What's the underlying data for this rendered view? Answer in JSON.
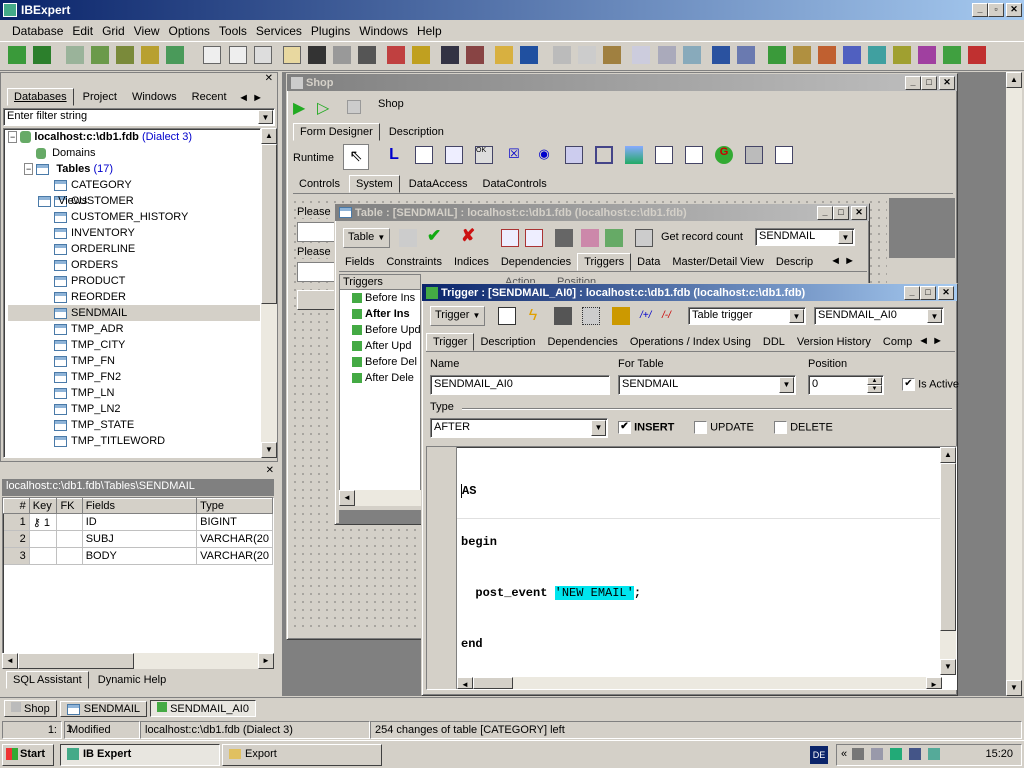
{
  "app": {
    "title": "IBExpert"
  },
  "menu": [
    "Database",
    "Edit",
    "Grid",
    "View",
    "Options",
    "Tools",
    "Services",
    "Plugins",
    "Windows",
    "Help"
  ],
  "dbexplorer": {
    "tabs": [
      "Databases",
      "Project",
      "Windows",
      "Recent"
    ],
    "filter_placeholder": "Enter filter string",
    "server": "localhost:c:\\db1.fdb",
    "dialect": "(Dialect 3)",
    "domains": "Domains",
    "tables_label": "Tables",
    "tables_count": "(17)",
    "tables": [
      "CATEGORY",
      "CUSTOMER",
      "CUSTOMER_HISTORY",
      "INVENTORY",
      "ORDERLINE",
      "ORDERS",
      "PRODUCT",
      "REORDER",
      "SENDMAIL",
      "TMP_ADR",
      "TMP_CITY",
      "TMP_FN",
      "TMP_FN2",
      "TMP_LN",
      "TMP_LN2",
      "TMP_STATE",
      "TMP_TITLEWORD"
    ],
    "views": "Views"
  },
  "fieldpanel": {
    "path": "localhost:c:\\db1.fdb\\Tables\\SENDMAIL",
    "headers": [
      "#",
      "Key",
      "FK",
      "Fields",
      "Type"
    ],
    "rows": [
      {
        "num": "1",
        "key": "⚷ 1",
        "field": "ID",
        "type": "BIGINT"
      },
      {
        "num": "2",
        "key": "",
        "field": "SUBJ",
        "type": "VARCHAR(20"
      },
      {
        "num": "3",
        "key": "",
        "field": "BODY",
        "type": "VARCHAR(20"
      }
    ],
    "bottom_tabs": [
      "SQL Assistant",
      "Dynamic Help"
    ]
  },
  "shop": {
    "title": "Shop",
    "name": "Shop",
    "tabs": [
      "Form Designer",
      "Description"
    ],
    "runtime": "Runtime",
    "palette_tabs": [
      "Controls",
      "System",
      "DataAccess",
      "DataControls"
    ],
    "please1": "Please",
    "please2": "Please"
  },
  "table": {
    "title": "Table : [SENDMAIL] : localhost:c:\\db1.fdb (localhost:c:\\db1.fdb)",
    "table_btn": "Table",
    "record_count": "Get record count",
    "table_name": "SENDMAIL",
    "tabs": [
      "Fields",
      "Constraints",
      "Indices",
      "Dependencies",
      "Triggers",
      "Data",
      "Master/Detail View",
      "Descrip"
    ],
    "triggers_header": "Triggers",
    "col_action": "Action",
    "col_position": "Position",
    "triggers": [
      "Before Ins",
      "After Ins",
      "Before Upd",
      "After Upd",
      "Before Del",
      "After Dele"
    ]
  },
  "trigger": {
    "title": "Trigger : [SENDMAIL_AI0] : localhost:c:\\db1.fdb (localhost:c:\\db1.fdb)",
    "trigger_btn": "Trigger",
    "kind": "Table trigger",
    "name_combo": "SENDMAIL_AI0",
    "tabs": [
      "Trigger",
      "Description",
      "Dependencies",
      "Operations / Index Using",
      "DDL",
      "Version History",
      "Comp"
    ],
    "name_label": "Name",
    "name_value": "SENDMAIL_AI0",
    "fortable_label": "For Table",
    "fortable_value": "SENDMAIL",
    "position_label": "Position",
    "position_value": "0",
    "isactive_label": "Is Active",
    "type_label": "Type",
    "type_value": "AFTER",
    "insert_label": "INSERT",
    "update_label": "UPDATE",
    "delete_label": "DELETE",
    "code": {
      "line1": "AS",
      "line2": "begin",
      "line3_pre": "  post_event ",
      "line3_str": "'NEW EMAIL'",
      "line3_post": ";",
      "line4": "end"
    }
  },
  "windowbar": [
    "Shop",
    "SENDMAIL",
    "SENDMAIL_AI0"
  ],
  "status": {
    "pos": "1:",
    "col": "1",
    "modified": "Modified",
    "db": "localhost:c:\\db1.fdb (Dialect 3)",
    "changes": "254 changes of table [CATEGORY] left"
  },
  "taskbar": {
    "start": "Start",
    "items": [
      "IB Expert",
      "Export"
    ],
    "lang": "DE",
    "time": "15:20"
  }
}
